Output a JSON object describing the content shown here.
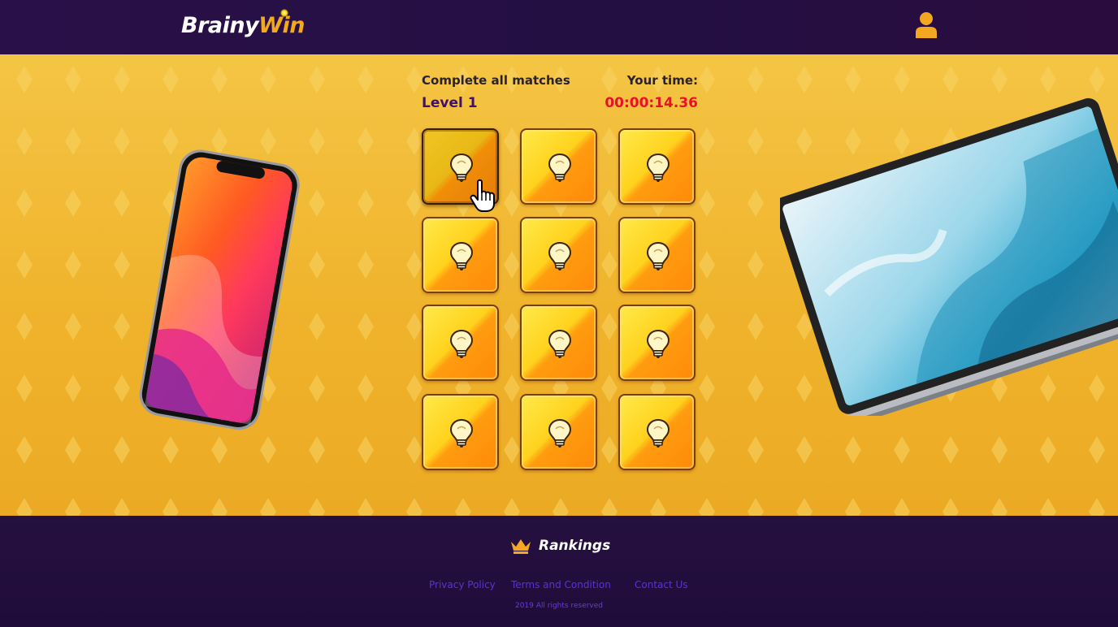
{
  "header": {
    "logo_part1": "Brainy",
    "logo_part2": "Win"
  },
  "game": {
    "instruction": "Complete all matches",
    "time_label": "Your time:",
    "level": "Level 1",
    "timer": "00:00:14.36",
    "grid": {
      "columns": 3,
      "rows": 4,
      "card_icon": "lightbulb-icon",
      "active_card": 1
    }
  },
  "footer": {
    "rankings_label": "Rankings",
    "links": [
      "Privacy Policy",
      "Terms and Condition",
      "Contact Us"
    ],
    "copyright": "2019 All rights reserved"
  },
  "colors": {
    "header_bg": "#2a1048",
    "stage_bg": "#f0b32c",
    "level_text": "#3f0f76",
    "timer_text": "#e8102b",
    "footer_link": "#5b31db",
    "accent": "#f3a91c"
  }
}
